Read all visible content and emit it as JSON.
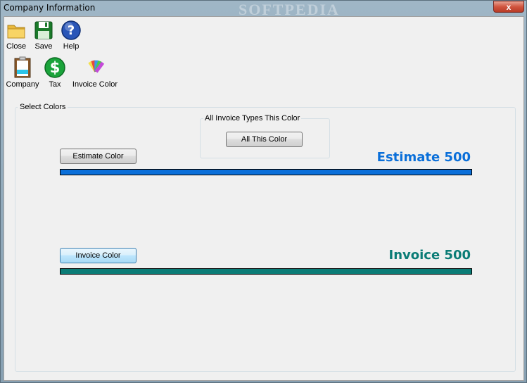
{
  "window": {
    "title": "Company Information",
    "watermark": "SOFTPEDIA",
    "close_glyph": "x"
  },
  "toolbar_main": {
    "items": [
      {
        "label": "Close",
        "icon": "folder-icon"
      },
      {
        "label": "Save",
        "icon": "floppy-disk-icon"
      },
      {
        "label": "Help",
        "icon": "help-icon"
      }
    ]
  },
  "toolbar_sections": {
    "items": [
      {
        "label": "Company",
        "icon": "clipboard-icon"
      },
      {
        "label": "Tax",
        "icon": "dollar-icon"
      },
      {
        "label": "Invoice Color",
        "icon": "color-palette-icon"
      }
    ]
  },
  "colors_group": {
    "label": "Select Colors",
    "all_types": {
      "label": "All Invoice Types This Color",
      "button": "All This Color"
    },
    "estimate": {
      "button": "Estimate Color",
      "preview_text": "Estimate 500",
      "color": "#0a6fd9"
    },
    "invoice": {
      "button": "Invoice Color",
      "preview_text": "Invoice 500",
      "color": "#0b7c76"
    }
  }
}
